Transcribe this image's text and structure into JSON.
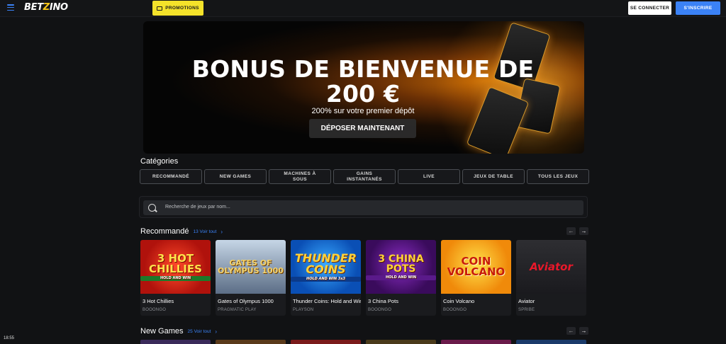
{
  "header": {
    "logo_prefix": "BET",
    "logo_z": "Z",
    "logo_suffix": "INO",
    "promotions_label": "PROMOTIONS",
    "login_label": "SE CONNECTER",
    "signup_label": "S'INSCRIRE",
    "accent_color": "#3b82f6",
    "promo_color": "#f4e22a"
  },
  "hero": {
    "title_line1": "BONUS DE BIENVENUE DE",
    "title_line2": "200 €",
    "subtitle": "200% sur votre premier dépôt",
    "cta_label": "DÉPOSER MAINTENANT"
  },
  "categories": {
    "title": "Catégories",
    "items": [
      {
        "label": "RECOMMANDÉ"
      },
      {
        "label": "NEW GAMES"
      },
      {
        "label": "MACHINES À SOUS"
      },
      {
        "label": "GAINS INSTANTANÉS"
      },
      {
        "label": "LIVE"
      },
      {
        "label": "JEUX DE TABLE"
      },
      {
        "label": "TOUS LES JEUX"
      }
    ]
  },
  "search": {
    "placeholder": "Recherche de jeux par nom..."
  },
  "recommended": {
    "title": "Recommandé",
    "view_all": "13 Voir tout",
    "games": [
      {
        "name": "3 Hot Chillies",
        "provider": "BOOONGO",
        "art": "3 HOT CHILLIES",
        "art_sub": "HOLD AND WIN"
      },
      {
        "name": "Gates of Olympus 1000",
        "provider": "PRAGMATIC PLAY",
        "art": "GATES OF OLYMPUS 1000",
        "art_sub": ""
      },
      {
        "name": "Thunder Coins: Hold and Win",
        "provider": "PLAYSON",
        "art": "THUNDER COINS",
        "art_sub": "HOLD AND WIN 3x3"
      },
      {
        "name": "3 China Pots",
        "provider": "BOOONGO",
        "art": "3 CHINA POTS",
        "art_sub": "HOLD AND WIN"
      },
      {
        "name": "Coin Volcano",
        "provider": "BOOONGO",
        "art": "COIN VOLCANO",
        "art_sub": ""
      },
      {
        "name": "Aviator",
        "provider": "SPRIBE",
        "art": "Aviator",
        "art_sub": ""
      }
    ]
  },
  "new_games": {
    "title": "New Games",
    "view_all": "25 Voir tout"
  },
  "clock": "18:55"
}
